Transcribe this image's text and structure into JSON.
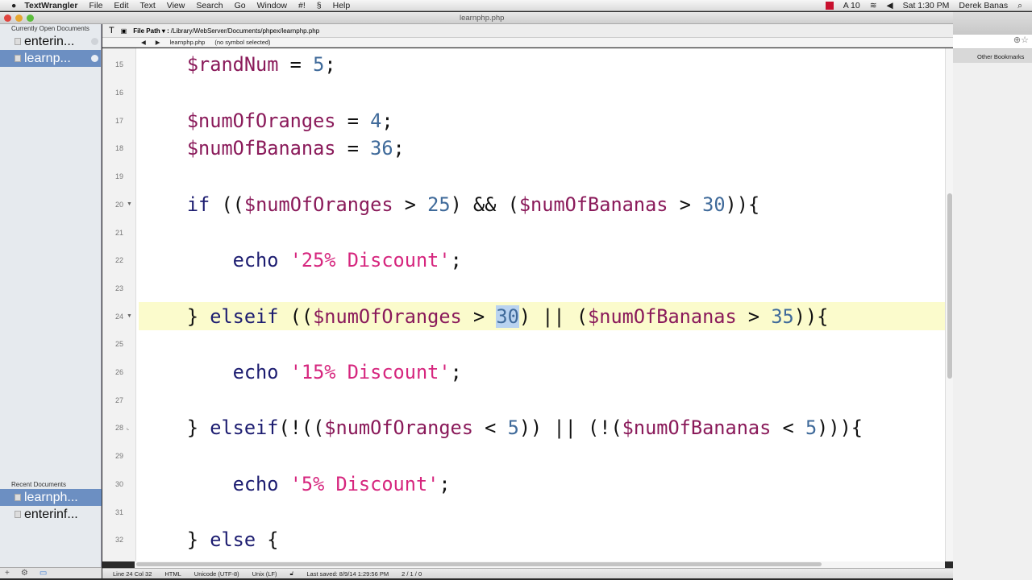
{
  "menubar": {
    "app": "TextWrangler",
    "items": [
      "File",
      "Edit",
      "Text",
      "View",
      "Search",
      "Go",
      "Window",
      "#!",
      "Help"
    ],
    "battery": "10",
    "clock": "Sat 1:30 PM",
    "user": "Derek Banas"
  },
  "window": {
    "title": "learnphp.php"
  },
  "sidebar": {
    "open_header": "Currently Open Documents",
    "open_docs": [
      "enterin...",
      "learnp..."
    ],
    "recent_header": "Recent Documents",
    "recent_docs": [
      "learnph...",
      "enterinf..."
    ]
  },
  "pathbar": {
    "label": "File Path ▾ :",
    "path": "/Library/WebServer/Documents/phpex/learnphp.php"
  },
  "navbar": {
    "file": "learnphp.php",
    "symbol": "(no symbol selected)"
  },
  "editor": {
    "lines": [
      {
        "n": "15",
        "t": [
          [
            "p",
            "    "
          ],
          [
            "var",
            "$randNum"
          ],
          [
            "p",
            " = "
          ],
          [
            "num",
            "5"
          ],
          [
            "p",
            ";"
          ]
        ]
      },
      {
        "n": "16",
        "t": []
      },
      {
        "n": "17",
        "t": [
          [
            "p",
            "    "
          ],
          [
            "var",
            "$numOfOranges"
          ],
          [
            "p",
            " = "
          ],
          [
            "num",
            "4"
          ],
          [
            "p",
            ";"
          ]
        ]
      },
      {
        "n": "18",
        "t": [
          [
            "p",
            "    "
          ],
          [
            "var",
            "$numOfBananas"
          ],
          [
            "p",
            " = "
          ],
          [
            "num",
            "36"
          ],
          [
            "p",
            ";"
          ]
        ]
      },
      {
        "n": "19",
        "t": []
      },
      {
        "n": "20",
        "fold": "▼",
        "t": [
          [
            "p",
            "    "
          ],
          [
            "kw",
            "if"
          ],
          [
            "p",
            " (("
          ],
          [
            "var",
            "$numOfOranges"
          ],
          [
            "p",
            " > "
          ],
          [
            "num",
            "25"
          ],
          [
            "p",
            ") && ("
          ],
          [
            "var",
            "$numOfBananas"
          ],
          [
            "p",
            " > "
          ],
          [
            "num",
            "30"
          ],
          [
            "p",
            ")){"
          ]
        ]
      },
      {
        "n": "21",
        "t": []
      },
      {
        "n": "22",
        "t": [
          [
            "p",
            "        "
          ],
          [
            "kw",
            "echo"
          ],
          [
            "p",
            " "
          ],
          [
            "str",
            "'25% Discount'"
          ],
          [
            "p",
            ";"
          ]
        ]
      },
      {
        "n": "23",
        "t": []
      },
      {
        "n": "24",
        "fold": "▼",
        "hl": true,
        "t": [
          [
            "p",
            "    } "
          ],
          [
            "kw",
            "elseif"
          ],
          [
            "p",
            " (("
          ],
          [
            "var",
            "$numOfOranges"
          ],
          [
            "p",
            " > "
          ],
          [
            "num sel",
            "30"
          ],
          [
            "p",
            ") || ("
          ],
          [
            "var",
            "$numOfBananas"
          ],
          [
            "p",
            " > "
          ],
          [
            "num",
            "35"
          ],
          [
            "p",
            ")){"
          ]
        ]
      },
      {
        "n": "25",
        "t": []
      },
      {
        "n": "26",
        "t": [
          [
            "p",
            "        "
          ],
          [
            "kw",
            "echo"
          ],
          [
            "p",
            " "
          ],
          [
            "str",
            "'15% Discount'"
          ],
          [
            "p",
            ";"
          ]
        ]
      },
      {
        "n": "27",
        "t": []
      },
      {
        "n": "28",
        "fold": "⌞",
        "t": [
          [
            "p",
            "    } "
          ],
          [
            "kw",
            "elseif"
          ],
          [
            "p",
            "(!(("
          ],
          [
            "var",
            "$numOfOranges"
          ],
          [
            "p",
            " < "
          ],
          [
            "num",
            "5"
          ],
          [
            "p",
            ")) || (!("
          ],
          [
            "var",
            "$numOfBananas"
          ],
          [
            "p",
            " < "
          ],
          [
            "num",
            "5"
          ],
          [
            "p",
            "))){"
          ]
        ]
      },
      {
        "n": "29",
        "t": []
      },
      {
        "n": "30",
        "t": [
          [
            "p",
            "        "
          ],
          [
            "kw",
            "echo"
          ],
          [
            "p",
            " "
          ],
          [
            "str",
            "'5% Discount'"
          ],
          [
            "p",
            ";"
          ]
        ]
      },
      {
        "n": "31",
        "t": []
      },
      {
        "n": "32",
        "t": [
          [
            "p",
            "    } "
          ],
          [
            "kw",
            "else"
          ],
          [
            "p",
            " {"
          ]
        ]
      }
    ]
  },
  "status": {
    "position": "Line 24 Col 32",
    "language": "HTML",
    "encoding": "Unicode (UTF-8)",
    "line_endings": "Unix (LF)",
    "saved": "Last saved: 8/9/14 1:29:56 PM",
    "counts": "2 / 1 / 0"
  },
  "browser": {
    "bookmarks": "Other Bookmarks"
  }
}
